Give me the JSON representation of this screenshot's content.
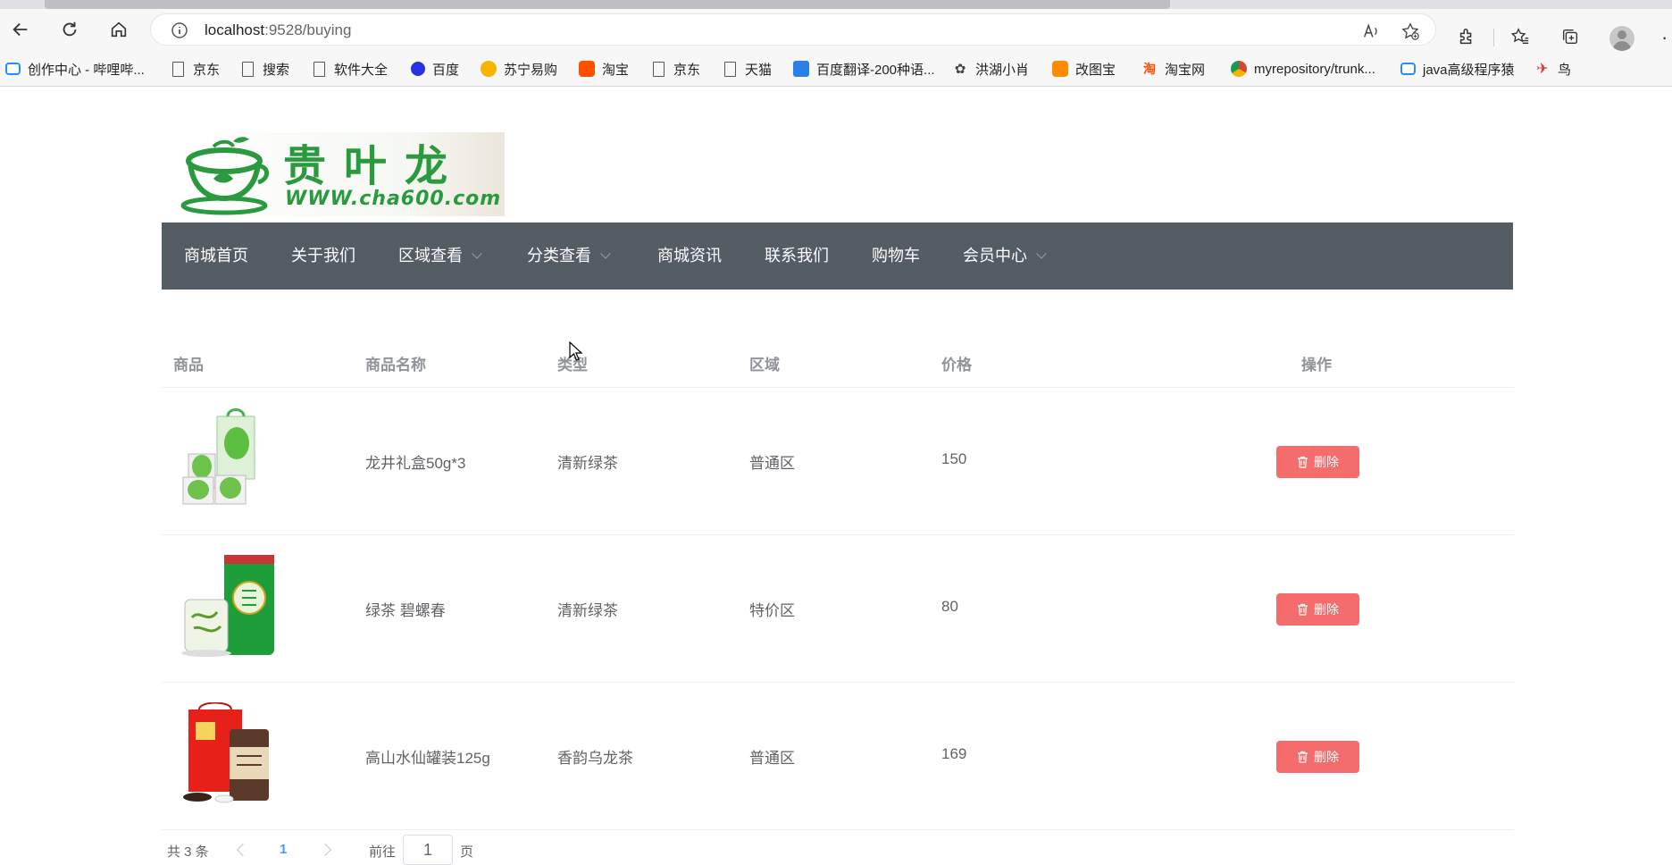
{
  "browser": {
    "url_host": "localhost",
    "url_path": ":9528/buying",
    "bookmarks": [
      {
        "label": "创作中心 - 哔哩哔...",
        "icon": "bilibili-icon"
      },
      {
        "label": "京东",
        "icon": "page-icon"
      },
      {
        "label": "搜索",
        "icon": "page-icon"
      },
      {
        "label": "软件大全",
        "icon": "page-icon"
      },
      {
        "label": "百度",
        "icon": "baidu-icon"
      },
      {
        "label": "苏宁易购",
        "icon": "suning-icon"
      },
      {
        "label": "淘宝",
        "icon": "taobao-icon"
      },
      {
        "label": "京东",
        "icon": "page-icon"
      },
      {
        "label": "天猫",
        "icon": "page-icon"
      },
      {
        "label": "百度翻译-200种语...",
        "icon": "baidu-translate-icon"
      },
      {
        "label": "洪湖小肖",
        "icon": "hongmen-icon"
      },
      {
        "label": "改图宝",
        "icon": "gaitubao-icon"
      },
      {
        "label": "淘宝网",
        "icon": "taobao-web-icon"
      },
      {
        "label": "myrepository/trunk...",
        "icon": "chrome-icon"
      },
      {
        "label": "java高级程序猿",
        "icon": "bilibili-icon"
      },
      {
        "label": "鸟",
        "icon": "bird-icon"
      }
    ]
  },
  "logo": {
    "brand": "贵叶龙",
    "site": "WWW.cha600.com"
  },
  "menu": [
    {
      "label": "商城首页",
      "dropdown": false
    },
    {
      "label": "关于我们",
      "dropdown": false
    },
    {
      "label": "区域查看",
      "dropdown": true
    },
    {
      "label": "分类查看",
      "dropdown": true
    },
    {
      "label": "商城资讯",
      "dropdown": false
    },
    {
      "label": "联系我们",
      "dropdown": false
    },
    {
      "label": "购物车",
      "dropdown": false
    },
    {
      "label": "会员中心",
      "dropdown": true
    }
  ],
  "table": {
    "headers": {
      "product": "商品",
      "name": "商品名称",
      "type": "类型",
      "region": "区域",
      "price": "价格",
      "action": "操作"
    },
    "rows": [
      {
        "name": "龙井礼盒50g*3",
        "type": "清新绿茶",
        "region": "普通区",
        "price": "150",
        "delete_label": "删除"
      },
      {
        "name": "绿茶 碧螺春",
        "type": "清新绿茶",
        "region": "特价区",
        "price": "80",
        "delete_label": "删除"
      },
      {
        "name": "高山水仙罐装125g",
        "type": "香韵乌龙茶",
        "region": "普通区",
        "price": "169",
        "delete_label": "删除"
      }
    ]
  },
  "pagination": {
    "total": "共 3 条",
    "current_page": "1",
    "goto_prefix": "前往",
    "goto_value": "1",
    "goto_suffix": "页"
  },
  "colors": {
    "menu_bg": "#545c64",
    "danger": "#f56c6c",
    "primary": "#409eff",
    "brand_green": "#2a9a3f"
  }
}
